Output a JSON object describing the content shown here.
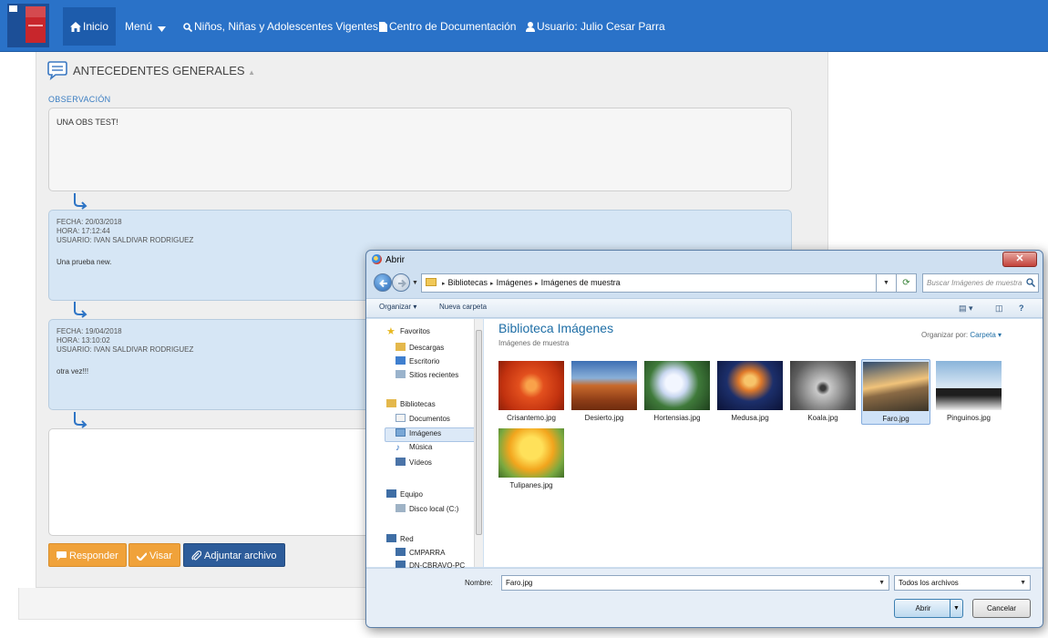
{
  "nav": {
    "inicio": "Inicio",
    "menu": "Menú",
    "ninos": "Niños, Niñas y Adolescentes Vigentes",
    "docs": "Centro de Documentación",
    "usuario": "Usuario: Julio Cesar Parra"
  },
  "section": {
    "title": "ANTECEDENTES GENERALES",
    "obs_label": "OBSERVACIÓN",
    "obs_text": "UNA OBS TEST!"
  },
  "entries": [
    {
      "fecha": "FECHA: 20/03/2018",
      "hora": "HORA: 17:12:44",
      "usuario": "USUARIO: IVAN SALDIVAR RODRIGUEZ",
      "msg": "Una prueba new."
    },
    {
      "fecha": "FECHA: 19/04/2018",
      "hora": "HORA: 13:10:02",
      "usuario": "USUARIO: IVAN SALDIVAR RODRIGUEZ",
      "msg": "otra vez!!!"
    }
  ],
  "buttons": {
    "responder": "Responder",
    "visar": "Visar",
    "adjuntar": "Adjuntar archivo"
  },
  "dialog": {
    "title": "Abrir",
    "path": [
      "Bibliotecas",
      "Imágenes",
      "Imágenes de muestra"
    ],
    "search_placeholder": "Buscar Imágenes de muestra",
    "toolbar": {
      "organizar": "Organizar ▾",
      "nueva_carpeta": "Nueva carpeta"
    },
    "nav_pane": {
      "favoritos": "Favoritos",
      "descargas": "Descargas",
      "escritorio": "Escritorio",
      "recientes": "Sitios recientes",
      "bibliotecas": "Bibliotecas",
      "documentos": "Documentos",
      "imagenes": "Imágenes",
      "musica": "Música",
      "videos": "Vídeos",
      "equipo": "Equipo",
      "disco": "Disco local (C:)",
      "red": "Red",
      "cmparra": "CMPARRA",
      "dncbravo": "DN-CBRAVO-PC"
    },
    "library_title": "Biblioteca Imágenes",
    "library_sub": "Imágenes de muestra",
    "organize_by_label": "Organizar por:",
    "organize_by_value": "Carpeta ▾",
    "files": [
      "Crisantemo.jpg",
      "Desierto.jpg",
      "Hortensias.jpg",
      "Medusa.jpg",
      "Koala.jpg",
      "Faro.jpg",
      "Pinguinos.jpg",
      "Tulipanes.jpg"
    ],
    "selected_file": "Faro.jpg",
    "filename_label": "Nombre:",
    "filename_value": "Faro.jpg",
    "filetype": "Todos los archivos",
    "open": "Abrir",
    "cancel": "Cancelar"
  },
  "colors": {
    "navbar": "#2a72c8",
    "entry_bg": "#d6e6f5",
    "orange": "#f0a23a",
    "navy_button": "#2d5c9a",
    "link": "#1e6ea6"
  }
}
